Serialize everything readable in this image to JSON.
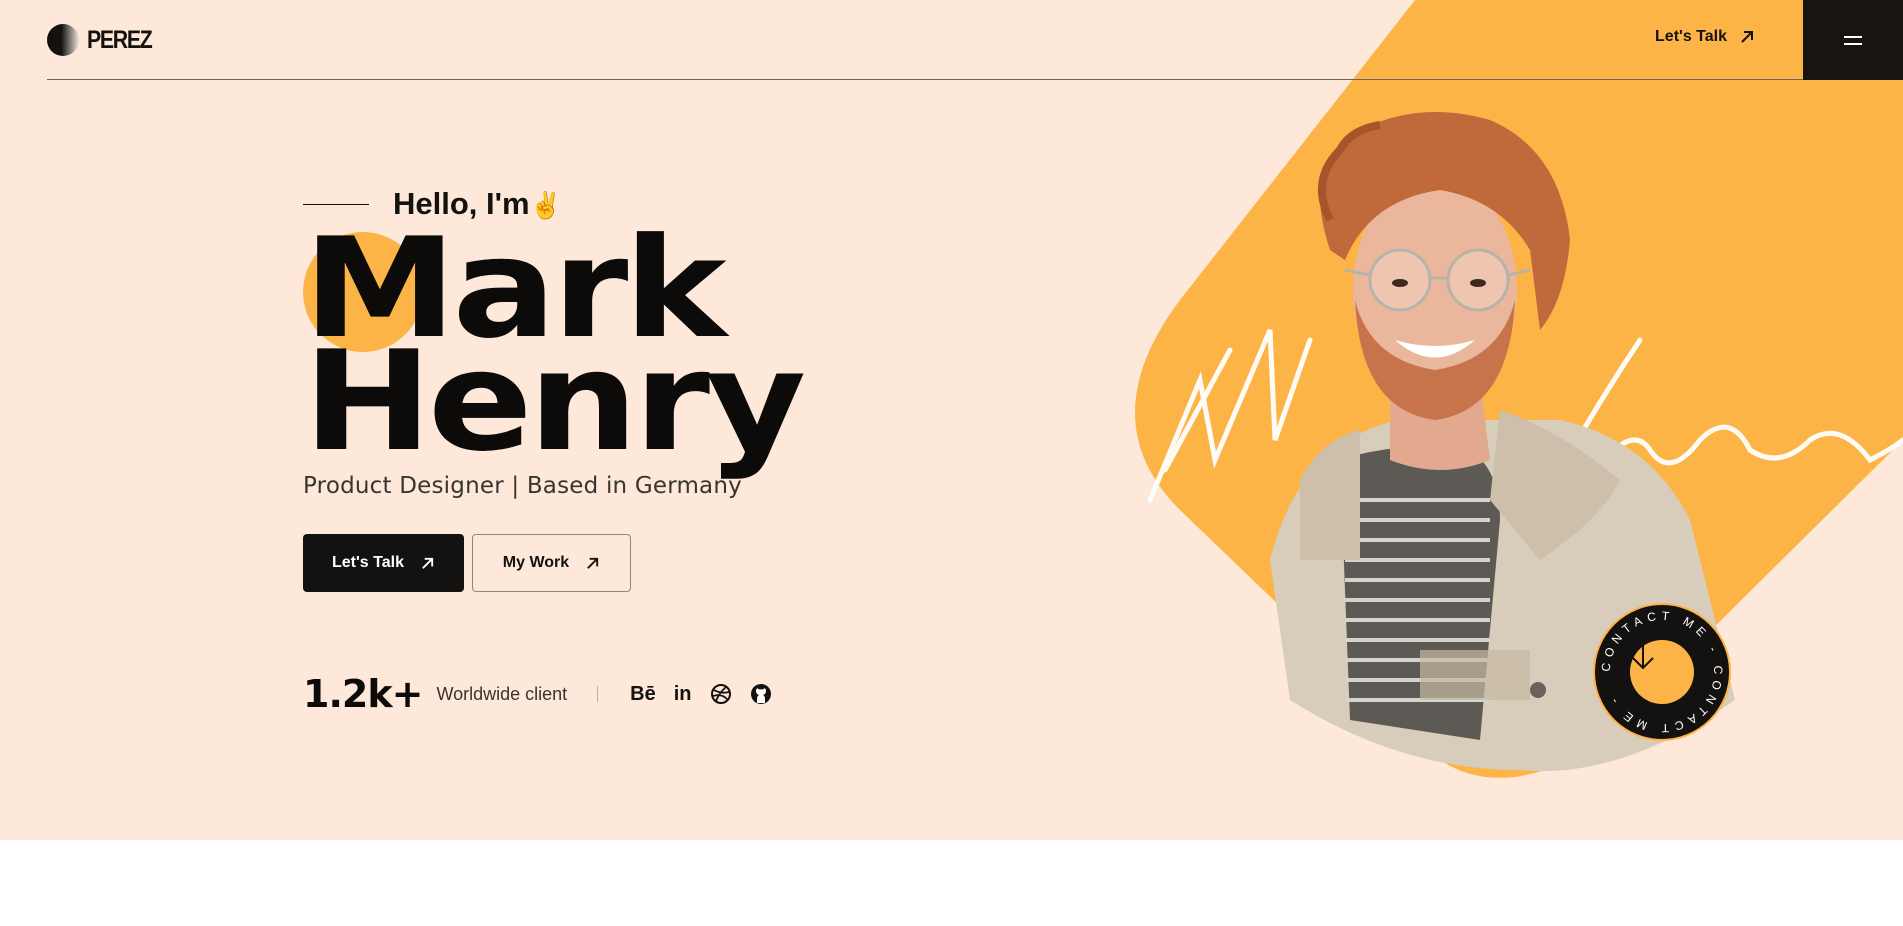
{
  "colors": {
    "background": "#fde8d9",
    "accent": "#fdb446",
    "dark": "#141210"
  },
  "header": {
    "logo_text": "PEREZ",
    "cta_label": "Let's Talk",
    "cta_icon": "arrow-up-right-icon",
    "menu_icon": "hamburger-icon"
  },
  "hero": {
    "greeting": "Hello, I'm",
    "greeting_emoji": "✌️",
    "first_name": "Mark",
    "last_name": "Henry",
    "subtitle": "Product Designer | Based in Germany",
    "buttons": {
      "primary": "Let's Talk",
      "secondary": "My Work"
    },
    "stats": {
      "value": "1.2k+",
      "label": "Worldwide client"
    },
    "socials": [
      {
        "name": "behance-icon",
        "label": "Bē"
      },
      {
        "name": "linkedin-icon",
        "label": "in"
      },
      {
        "name": "dribbble-icon",
        "label": ""
      },
      {
        "name": "github-icon",
        "label": ""
      }
    ],
    "contact_badge_text": "CONTACT ME - CONTACT ME -"
  }
}
